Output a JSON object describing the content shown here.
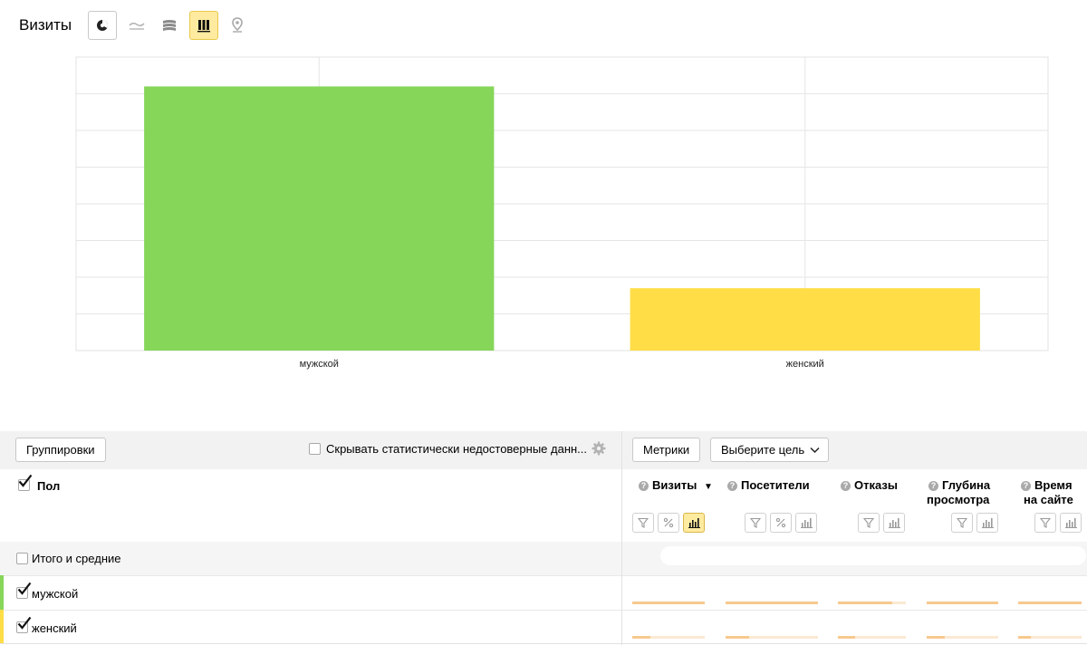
{
  "header": {
    "title": "Визиты",
    "view_buttons": [
      {
        "name": "pie-chart",
        "active": false
      },
      {
        "name": "line-chart",
        "active": false
      },
      {
        "name": "area-chart",
        "active": false
      },
      {
        "name": "bar-chart",
        "active": true
      },
      {
        "name": "map",
        "active": false
      }
    ]
  },
  "chart_data": {
    "type": "bar",
    "title": "",
    "xlabel": "",
    "ylabel": "",
    "categories": [
      "мужской",
      "женский"
    ],
    "values": [
      72,
      17
    ],
    "colors": [
      "#86d65a",
      "#ffdd47"
    ],
    "ylim": [
      0,
      80
    ],
    "grid": true
  },
  "toolbar": {
    "groupings_label": "Группировки",
    "hide_unreliable_label": "Скрывать статистически недостоверные данн...",
    "hide_unreliable_checked": false,
    "metrics_label": "Метрики",
    "goal_label": "Выберите цель"
  },
  "table": {
    "dimension_header": "Пол",
    "dimension_checked": true,
    "columns": [
      {
        "label": "Визиты",
        "line2": "",
        "sorted_desc": true,
        "sort_arrow": "▼"
      },
      {
        "label": "Посетители",
        "line2": ""
      },
      {
        "label": "Отказы",
        "line2": ""
      },
      {
        "label": "Глубина",
        "line2": "просмотра"
      },
      {
        "label": "Время",
        "line2": "на сайте"
      }
    ],
    "total_row_label": "Итого и средние",
    "total_checked": false,
    "rows": [
      {
        "label": "мужской",
        "checked": true,
        "color": "#86d65a",
        "fills": [
          1.0,
          1.0,
          0.8,
          1.0,
          1.0
        ]
      },
      {
        "label": "женский",
        "checked": true,
        "color": "#ffdd47",
        "fills": [
          0.25,
          0.25,
          0.25,
          0.25,
          0.2
        ]
      }
    ]
  }
}
